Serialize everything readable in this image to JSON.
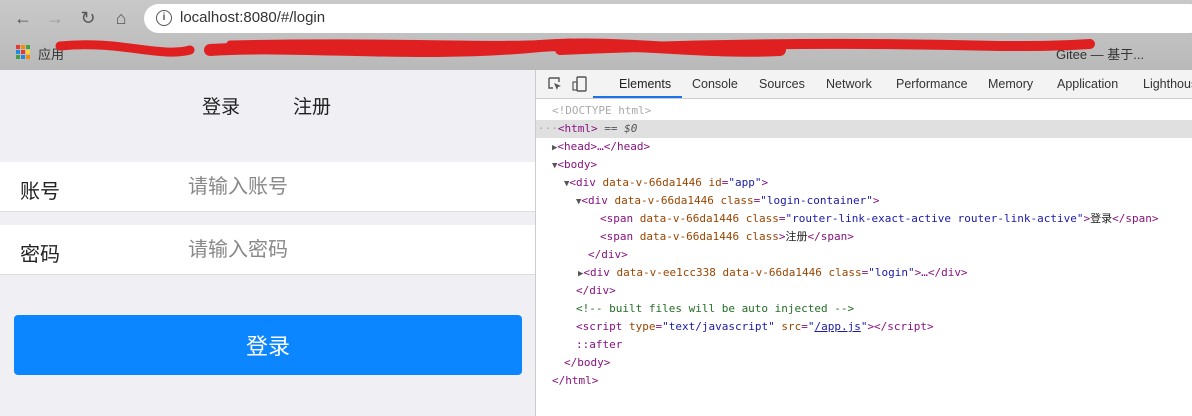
{
  "browser": {
    "url": "localhost:8080/#/login",
    "bookmarks": {
      "apps_label": "应用",
      "last_label": "Gitee — 基于..."
    }
  },
  "page": {
    "tabs": [
      "登录",
      "注册"
    ],
    "account": {
      "label": "账号",
      "placeholder": "请输入账号",
      "value": ""
    },
    "password": {
      "label": "密码",
      "placeholder": "请输入密码",
      "value": ""
    },
    "login_button": "登录",
    "colors": {
      "button": "#0c86ff",
      "background": "#efeff4"
    }
  },
  "devtools": {
    "tabs": [
      "Elements",
      "Console",
      "Sources",
      "Network",
      "Performance",
      "Memory",
      "Application",
      "Lighthouse"
    ],
    "active_tab": "Elements",
    "tree": {
      "doctype": "<!DOCTYPE html>",
      "html_sel": "<html>",
      "sel_suffix": " == $0",
      "head": "<head>…</head>",
      "body_open": "<body>",
      "app_tag": "<div ",
      "app_attr1": "data-v-66da1446 ",
      "app_attr2": "id",
      "app_val": "\"app\"",
      "lc_attr1": "data-v-66da1446 ",
      "lc_attr2": "class",
      "lc_val": "\"login-container\"",
      "span1_attr1": "data-v-66da1446 ",
      "span1_attr2": "class",
      "span1_val": "\"router-link-exact-active router-link-active\"",
      "span1_text": "登录",
      "span2_attr": "data-v-66da1446 class",
      "span2_text": "注册",
      "login_attr1": "data-v-ee1cc338 data-v-66da1446 ",
      "login_attr2": "class",
      "login_val": "\"login\"",
      "comment": "<!-- built files will be auto injected -->",
      "script_attr1": "type",
      "script_val1": "\"text/javascript\"",
      "script_attr2": " src",
      "script_src": "/app.js",
      "after": "::after",
      "body_close": "</body>",
      "html_close": "</html>"
    }
  }
}
